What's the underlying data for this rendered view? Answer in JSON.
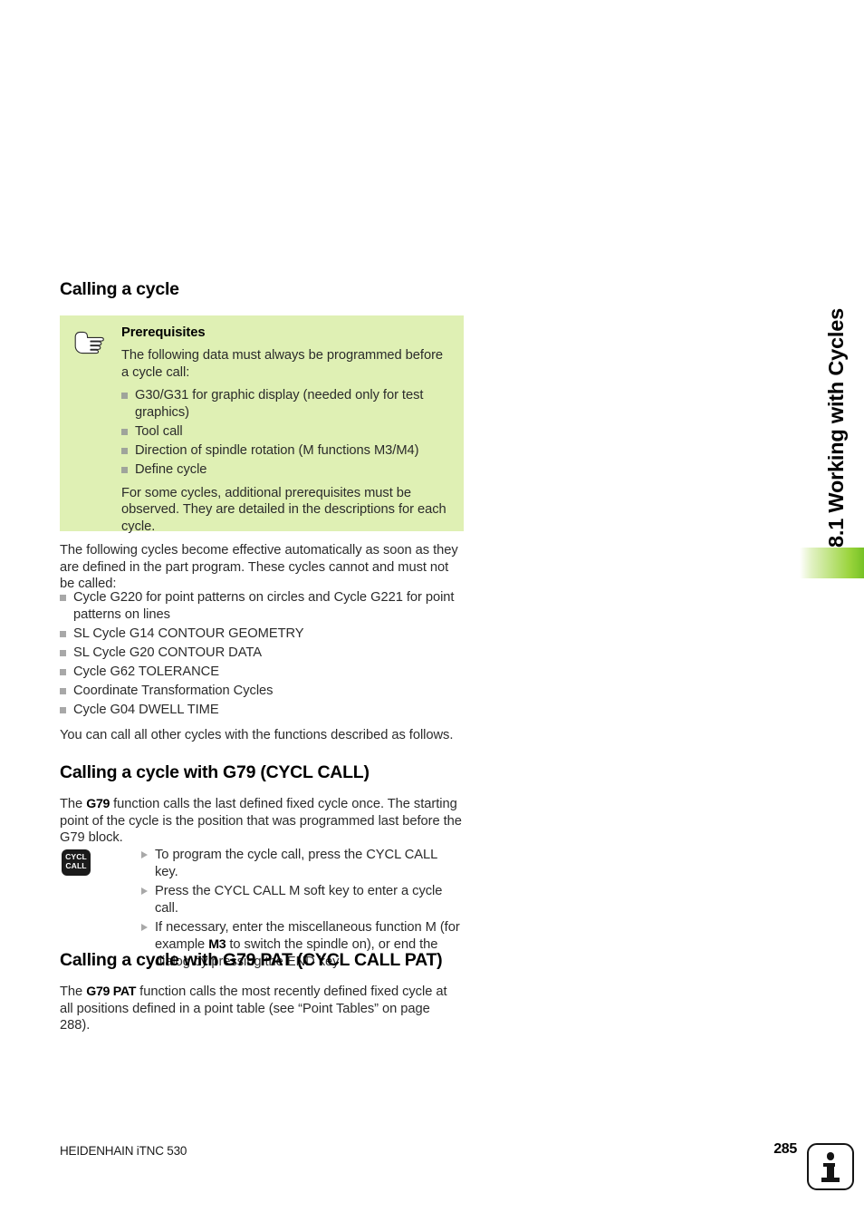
{
  "chapter": {
    "tab_label": "8.1 Working with Cycles",
    "accent_color": "#8fcc35"
  },
  "sections": {
    "calling_a_cycle": {
      "heading": "Calling a cycle",
      "note": {
        "icon": "pointing-hand-icon",
        "background_color": "#dff0b4",
        "title": "Prerequisites",
        "intro": "The following data must always be programmed before a cycle call:",
        "items": [
          "G30/G31 for graphic display (needed only for test graphics)",
          "Tool call",
          "Direction of spindle rotation (M functions M3/M4)",
          "Define cycle"
        ],
        "outro": "For some cycles, additional prerequisites must be observed. They are detailed in the descriptions for each cycle."
      },
      "intro_paragraph": "The following cycles become effective automatically as soon as they are defined in the part program. These cycles cannot and must not be called:",
      "auto_cycles": [
        "Cycle G220 for point patterns on circles and Cycle G221 for point patterns on lines",
        "SL Cycle G14 CONTOUR GEOMETRY",
        "SL Cycle G20 CONTOUR DATA",
        "Cycle G62 TOLERANCE",
        "Coordinate Transformation Cycles",
        "Cycle G04 DWELL TIME"
      ],
      "closing_paragraph": "You can call all other cycles with the functions described as follows."
    },
    "cycl_call": {
      "heading": "Calling a cycle with G79 (CYCL CALL)",
      "paragraph_pre": "The ",
      "paragraph_code": "G79",
      "paragraph_post": " function calls the last defined fixed cycle once. The starting point of the cycle is the position that was programmed last before the G79 block.",
      "key": {
        "line1": "CYCL",
        "line2": "CALL"
      },
      "steps": [
        "To program the cycle call, press the CYCL CALL key.",
        "Press the CYCL CALL M soft key to enter a cycle call."
      ],
      "step3_pre": "If necessary, enter the miscellaneous function M (for example ",
      "step3_code": "M3",
      "step3_post": " to switch the spindle on), or end the dialog by pressing the END key"
    },
    "cycl_call_pat": {
      "heading": "Calling a cycle with G79 PAT (CYCL CALL PAT)",
      "paragraph_pre": "The ",
      "paragraph_code": "G79  PAT",
      "paragraph_post": " function calls the most recently defined fixed cycle at all positions defined in a point table (see “Point Tables” on page 288)."
    }
  },
  "footer": {
    "product": "HEIDENHAIN iTNC 530",
    "page_number": "285",
    "badge_icon": "info-icon"
  }
}
